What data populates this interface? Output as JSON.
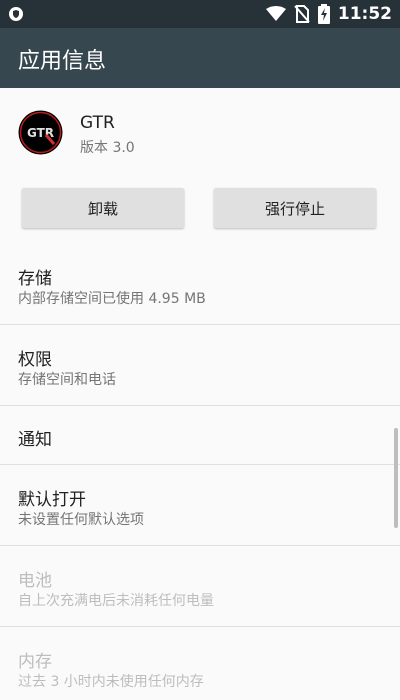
{
  "status_bar": {
    "time": "11:52"
  },
  "app_bar": {
    "title": "应用信息"
  },
  "app": {
    "name": "GTR",
    "version": "版本 3.0",
    "icon_text": "GTR"
  },
  "buttons": {
    "uninstall": "卸载",
    "force_stop": "强行停止"
  },
  "items": [
    {
      "title": "存储",
      "summary": "内部存储空间已使用 4.95 MB"
    },
    {
      "title": "权限",
      "summary": "存储空间和电话"
    },
    {
      "title": "通知"
    },
    {
      "title": "默认打开",
      "summary": "未设置任何默认选项"
    },
    {
      "title": "电池",
      "summary": "自上次充满电后未消耗任何电量"
    },
    {
      "title": "内存",
      "summary": "过去 3 小时内未使用任何内存"
    }
  ]
}
